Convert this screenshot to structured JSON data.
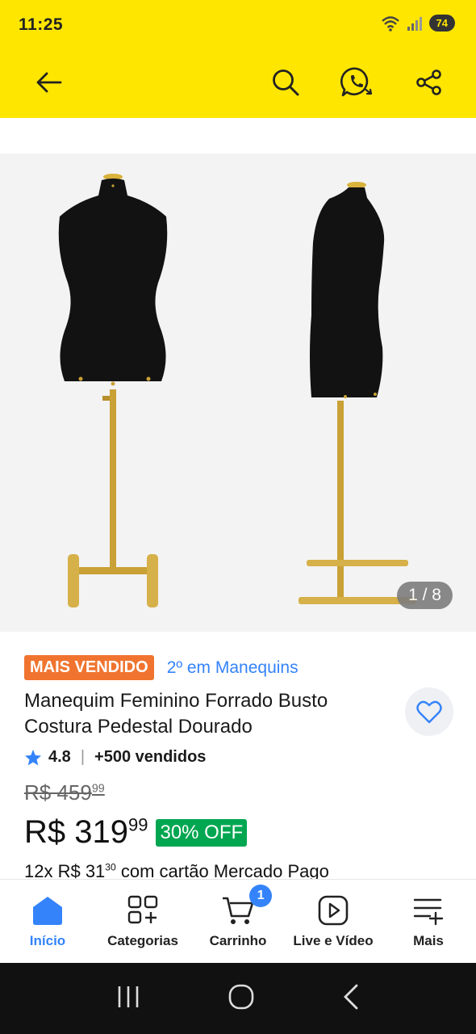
{
  "status_bar": {
    "time": "11:25",
    "battery": "74",
    "signal_label": "5"
  },
  "header": {
    "back_icon": "arrow-left-icon",
    "search_icon": "search-icon",
    "whatsapp_icon": "whatsapp-icon",
    "share_icon": "share-icon",
    "background": "#ffe600"
  },
  "gallery": {
    "counter": "1 / 8"
  },
  "product": {
    "badge": "MAIS VENDIDO",
    "rank": "2º em Manequins",
    "title": "Manequim Feminino Forrado Busto Costura Pedestal Dourado",
    "rating": "4.8",
    "sold": "+500 vendidos",
    "old_price_main": "R$ 459",
    "old_price_cents": "99",
    "price_main": "R$ 319",
    "price_cents": "99",
    "discount": "30% OFF",
    "installment_prefix": "12x R$ 31",
    "installment_cents": "30",
    "installment_suffix": " com cartão Mercado Pago"
  },
  "bottom_nav": {
    "items": [
      {
        "label": "Início",
        "icon": "home-icon",
        "active": true
      },
      {
        "label": "Categorias",
        "icon": "categories-icon"
      },
      {
        "label": "Carrinho",
        "icon": "cart-icon",
        "badge": "1"
      },
      {
        "label": "Live e Vídeo",
        "icon": "play-icon"
      },
      {
        "label": "Mais",
        "icon": "menu-plus-icon"
      }
    ]
  },
  "colors": {
    "accent": "#3483fa",
    "best_seller": "#f0742f",
    "discount": "#00a650"
  }
}
